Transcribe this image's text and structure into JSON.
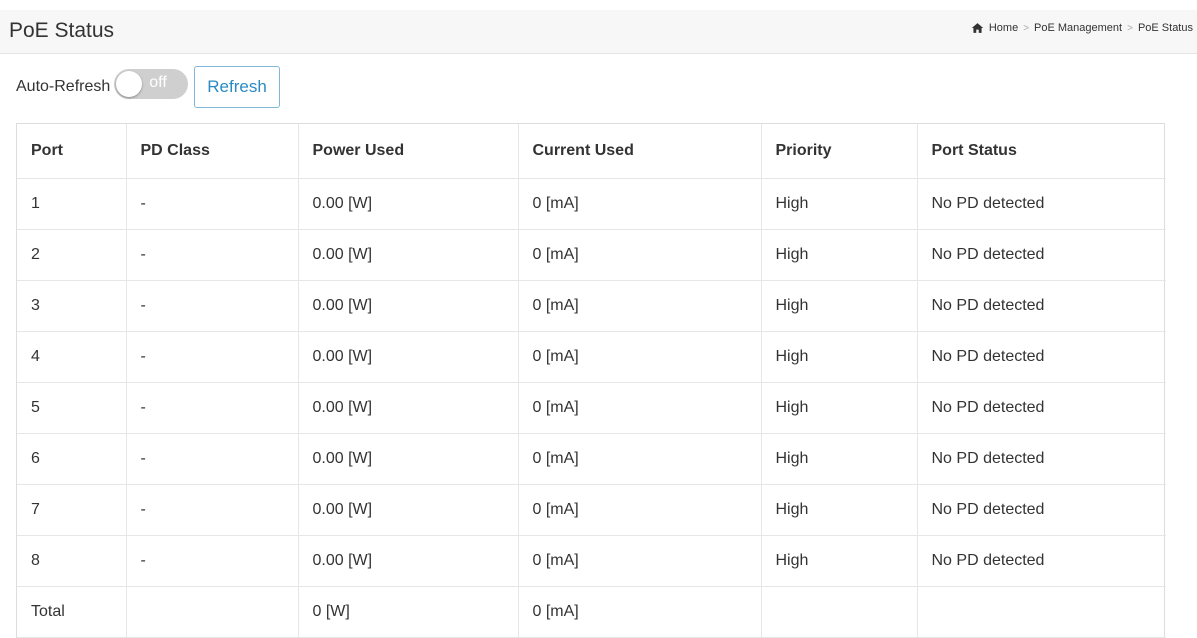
{
  "header": {
    "title": "PoE Status",
    "breadcrumb": [
      "Home",
      "PoE Management",
      "PoE Status"
    ]
  },
  "toolbar": {
    "auto_refresh_label": "Auto-Refresh",
    "toggle_state": "off",
    "refresh_label": "Refresh"
  },
  "table": {
    "columns": [
      "Port",
      "PD Class",
      "Power Used",
      "Current Used",
      "Priority",
      "Port Status"
    ],
    "rows": [
      {
        "port": "1",
        "pd_class": "-",
        "power": "0.00 [W]",
        "current": "0 [mA]",
        "priority": "High",
        "status": "No PD detected"
      },
      {
        "port": "2",
        "pd_class": "-",
        "power": "0.00 [W]",
        "current": "0 [mA]",
        "priority": "High",
        "status": "No PD detected"
      },
      {
        "port": "3",
        "pd_class": "-",
        "power": "0.00 [W]",
        "current": "0 [mA]",
        "priority": "High",
        "status": "No PD detected"
      },
      {
        "port": "4",
        "pd_class": "-",
        "power": "0.00 [W]",
        "current": "0 [mA]",
        "priority": "High",
        "status": "No PD detected"
      },
      {
        "port": "5",
        "pd_class": "-",
        "power": "0.00 [W]",
        "current": "0 [mA]",
        "priority": "High",
        "status": "No PD detected"
      },
      {
        "port": "6",
        "pd_class": "-",
        "power": "0.00 [W]",
        "current": "0 [mA]",
        "priority": "High",
        "status": "No PD detected"
      },
      {
        "port": "7",
        "pd_class": "-",
        "power": "0.00 [W]",
        "current": "0 [mA]",
        "priority": "High",
        "status": "No PD detected"
      },
      {
        "port": "8",
        "pd_class": "-",
        "power": "0.00 [W]",
        "current": "0 [mA]",
        "priority": "High",
        "status": "No PD detected"
      }
    ],
    "total": {
      "port": "Total",
      "pd_class": "",
      "power": "0 [W]",
      "current": "0 [mA]",
      "priority": "",
      "status": ""
    }
  },
  "colors": {
    "accent": "#2a8bc2",
    "header_bg": "#f7f7f7",
    "toggle_off": "#cfcfcf"
  },
  "icons": {
    "home": "home-icon"
  }
}
